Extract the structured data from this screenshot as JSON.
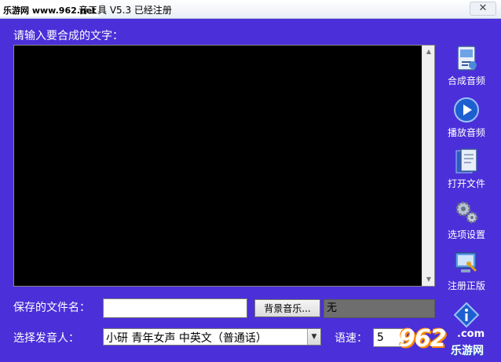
{
  "window": {
    "watermark": "乐游网 www.962.net",
    "title": "音工具 V5.3 已经注册",
    "close_glyph": "✕"
  },
  "editor": {
    "prompt": "请输入要合成的文字：",
    "text": ""
  },
  "file": {
    "label": "保存的文件名：",
    "value": "",
    "bgm_button": "背景音乐...",
    "bgm_value": "无"
  },
  "voice": {
    "label": "选择发音人：",
    "selected": "小研  青年女声  中英文（普通话）"
  },
  "speed": {
    "label": "语速：",
    "value": "5"
  },
  "toolbar": [
    {
      "label": "合成音频",
      "icon": "synthesize-icon"
    },
    {
      "label": "播放音频",
      "icon": "play-icon"
    },
    {
      "label": "打开文件",
      "icon": "open-file-icon"
    },
    {
      "label": "选项设置",
      "icon": "settings-gear-icon"
    },
    {
      "label": "注册正版",
      "icon": "register-icon"
    }
  ],
  "logo": {
    "number": "962",
    "dotcom": ".com",
    "text": "乐游网"
  }
}
